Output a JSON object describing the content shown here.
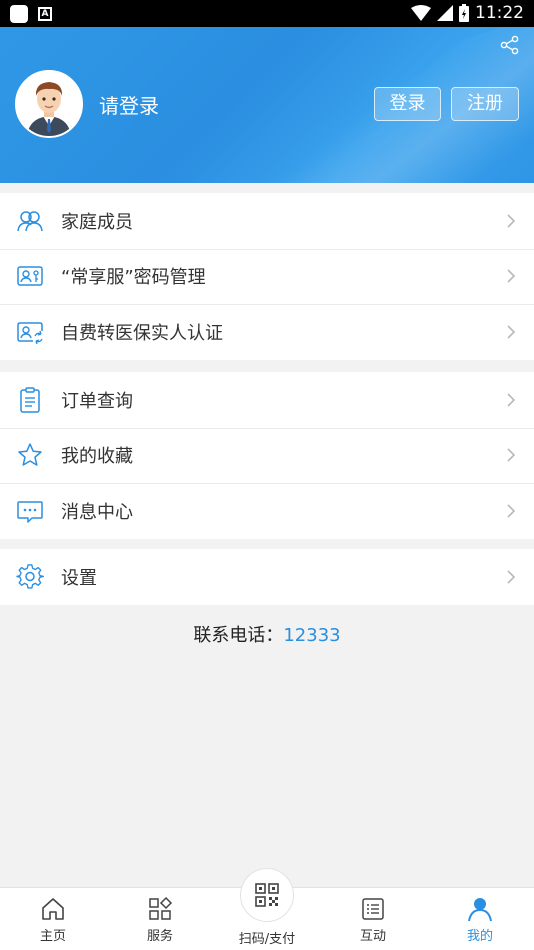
{
  "status_bar": {
    "time": "11:22",
    "notification_icon_text": "A"
  },
  "header": {
    "login_prompt": "请登录",
    "login_button": "登录",
    "register_button": "注册"
  },
  "menu": {
    "group1": [
      {
        "label": "家庭成员",
        "icon": "family-icon"
      },
      {
        "label": "“常享服”密码管理",
        "icon": "id-card-key-icon"
      },
      {
        "label": "自费转医保实人认证",
        "icon": "id-card-verify-icon"
      }
    ],
    "group2": [
      {
        "label": "订单查询",
        "icon": "clipboard-icon"
      },
      {
        "label": "我的收藏",
        "icon": "star-icon"
      },
      {
        "label": "消息中心",
        "icon": "message-icon"
      }
    ],
    "group3": [
      {
        "label": "设置",
        "icon": "gear-icon"
      }
    ]
  },
  "contact": {
    "label": "联系电话：",
    "phone": "12333"
  },
  "tabbar": {
    "home": "主页",
    "service": "服务",
    "scan": "扫码/支付",
    "interact": "互动",
    "mine": "我的"
  },
  "colors": {
    "accent": "#2a8fe0",
    "header": "#2f98e6",
    "background": "#f2f2f2"
  }
}
